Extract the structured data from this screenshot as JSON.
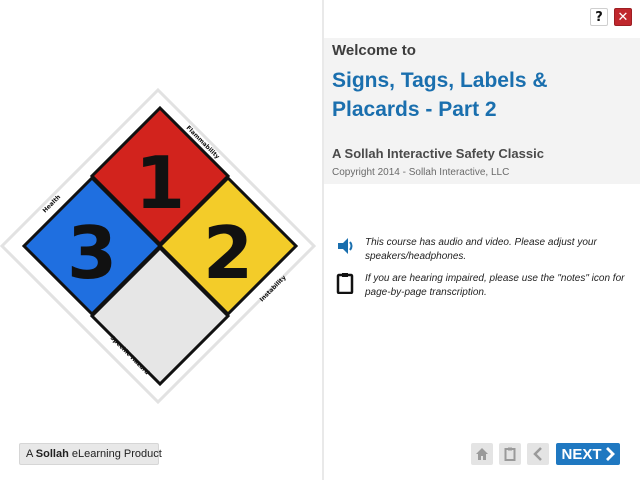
{
  "placard": {
    "health": "3",
    "flammability": "1",
    "instability": "2",
    "labels": {
      "health": "Health",
      "flammability": "Flammability",
      "instability": "Instability",
      "specific_hazard": "Specific Hazard"
    },
    "colors": {
      "health": "#1f6fe0",
      "flammability": "#d2231d",
      "instability": "#f3cc29",
      "specific_hazard": "#e6e6e6"
    }
  },
  "brand": {
    "prefix": "A",
    "name": "Sollah",
    "suffix": "eLearning Product"
  },
  "top_icons": {
    "help": "?",
    "close": "✕"
  },
  "header": {
    "welcome": "Welcome to",
    "title": "Signs, Tags, Labels & Placards - Part 2",
    "subtitle": "A Sollah Interactive Safety Classic",
    "copyright": "Copyright 2014 - Sollah Interactive, LLC"
  },
  "notices": [
    {
      "icon": "speaker-icon",
      "text": "This course has audio and video. Please adjust your speakers/headphones."
    },
    {
      "icon": "clipboard-icon",
      "text": "If you are hearing impaired, please use the \"notes\" icon for page-by-page transcription."
    }
  ],
  "nav": {
    "home_icon": "home-icon",
    "notes_icon": "notes-icon",
    "back_icon": "chevron-left-icon",
    "next_label": "NEXT"
  },
  "colors": {
    "accent": "#1f78c1",
    "title": "#1a6fae",
    "close": "#c0272d"
  }
}
